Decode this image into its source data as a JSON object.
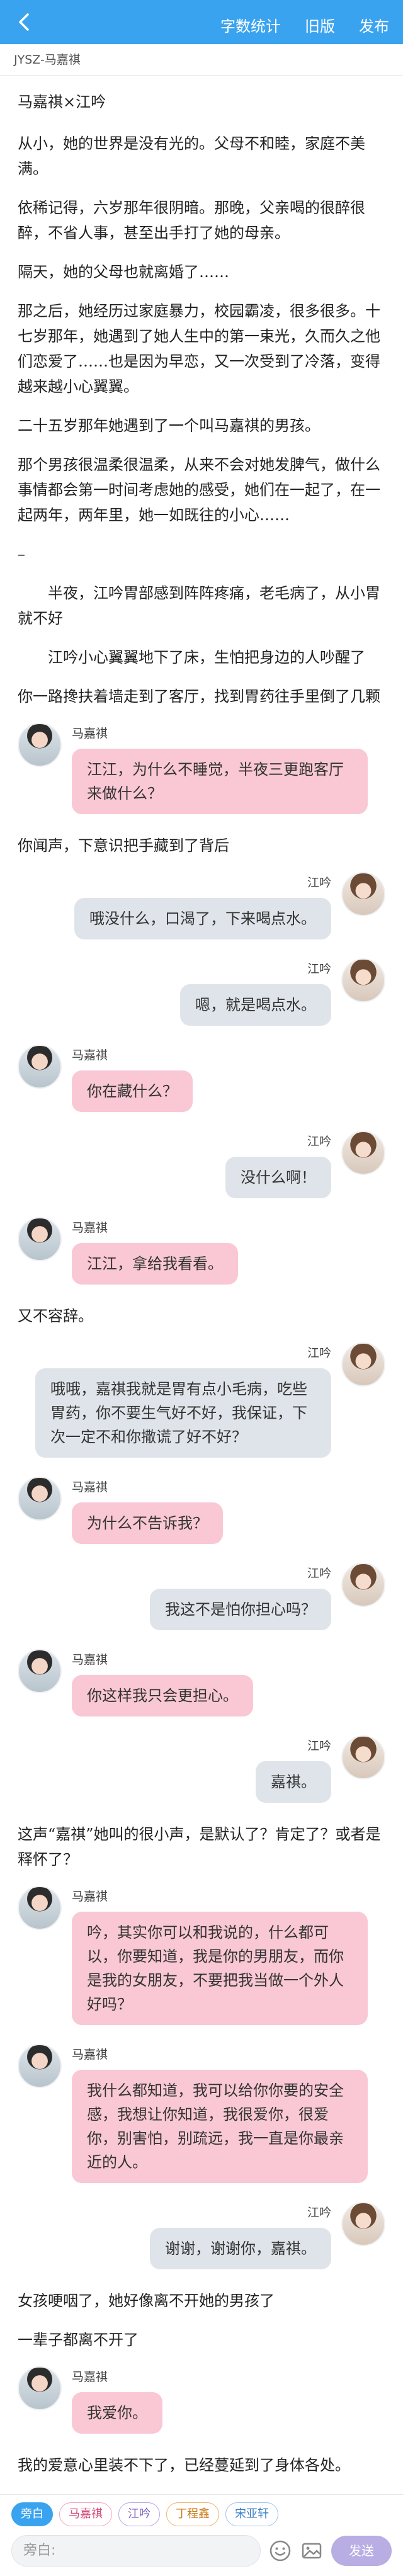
{
  "header": {
    "actions": [
      "字数统计",
      "旧版",
      "发布"
    ]
  },
  "meta": {
    "tag": "JYSZ-马嘉祺"
  },
  "blocks": [
    {
      "kind": "para",
      "style": "title",
      "text": "马嘉祺×江吟"
    },
    {
      "kind": "para",
      "text": "从小，她的世界是没有光的。父母不和睦，家庭不美满。"
    },
    {
      "kind": "para",
      "text": "依稀记得，六岁那年很阴暗。那晚，父亲喝的很醉很醉，不省人事，甚至出手打了她的母亲。"
    },
    {
      "kind": "para",
      "text": "隔天，她的父母也就离婚了……"
    },
    {
      "kind": "para",
      "text": "那之后，她经历过家庭暴力，校园霸凌，很多很多。十七岁那年，她遇到了她人生中的第一束光，久而久之他们恋爱了……也是因为早恋，又一次受到了冷落，变得越来越小心翼翼。"
    },
    {
      "kind": "para",
      "text": "二十五岁那年她遇到了一个叫马嘉祺的男孩。"
    },
    {
      "kind": "para",
      "text": "那个男孩很温柔很温柔，从来不会对她发脾气，做什么事情都会第一时间考虑她的感受，她们在一起了，在一起两年，两年里，她一如既往的小心……"
    },
    {
      "kind": "para",
      "text": "–"
    },
    {
      "kind": "para",
      "style": "indent",
      "text": "半夜，江吟胃部感到阵阵疼痛，老毛病了，从小胃就不好"
    },
    {
      "kind": "para",
      "style": "indent",
      "text": "江吟小心翼翼地下了床，生怕把身边的人吵醒了"
    },
    {
      "kind": "para",
      "text": "你一路搀扶着墙走到了客厅，找到胃药往手里倒了几颗"
    },
    {
      "kind": "msg",
      "side": "left",
      "sender": "马嘉祺",
      "text": "江江，为什么不睡觉，半夜三更跑客厅来做什么？"
    },
    {
      "kind": "para",
      "text": "你闻声，下意识把手藏到了背后"
    },
    {
      "kind": "msg",
      "side": "right",
      "sender": "江吟",
      "text": "哦没什么，口渴了，下来喝点水。"
    },
    {
      "kind": "msg",
      "side": "right",
      "sender": "江吟",
      "text": "嗯，就是喝点水。"
    },
    {
      "kind": "msg",
      "side": "left",
      "sender": "马嘉祺",
      "text": "你在藏什么？"
    },
    {
      "kind": "msg",
      "side": "right",
      "sender": "江吟",
      "text": "没什么啊！"
    },
    {
      "kind": "msg",
      "side": "left",
      "sender": "马嘉祺",
      "text": "江江，拿给我看看。"
    },
    {
      "kind": "para",
      "text": "又不容辞。"
    },
    {
      "kind": "msg",
      "side": "right",
      "sender": "江吟",
      "text": "哦哦，嘉祺我就是胃有点小毛病，吃些胃药，你不要生气好不好，我保证，下次一定不和你撒谎了好不好？"
    },
    {
      "kind": "msg",
      "side": "left",
      "sender": "马嘉祺",
      "text": "为什么不告诉我？"
    },
    {
      "kind": "msg",
      "side": "right",
      "sender": "江吟",
      "text": "我这不是怕你担心吗？"
    },
    {
      "kind": "msg",
      "side": "left",
      "sender": "马嘉祺",
      "text": "你这样我只会更担心。"
    },
    {
      "kind": "msg",
      "side": "right",
      "sender": "江吟",
      "text": "嘉祺。"
    },
    {
      "kind": "para",
      "text": "这声“嘉祺”她叫的很小声，是默认了？肯定了？或者是释怀了？"
    },
    {
      "kind": "msg",
      "side": "left",
      "sender": "马嘉祺",
      "text": "吟，其实你可以和我说的，什么都可以，你要知道，我是你的男朋友，而你是我的女朋友，不要把我当做一个外人好吗？"
    },
    {
      "kind": "msg",
      "side": "left",
      "sender": "马嘉祺",
      "text": "我什么都知道，我可以给你你要的安全感，我想让你知道，我很爱你，很爱你，别害怕，别疏远，我一直是你最亲近的人。"
    },
    {
      "kind": "msg",
      "side": "right",
      "sender": "江吟",
      "text": "谢谢，谢谢你，嘉祺。"
    },
    {
      "kind": "para",
      "text": "女孩哽咽了，她好像离不开她的男孩了"
    },
    {
      "kind": "para",
      "text": "一辈子都离不开了"
    },
    {
      "kind": "msg",
      "side": "left",
      "sender": "马嘉祺",
      "text": "我爱你。"
    },
    {
      "kind": "para",
      "text": "我的爱意心里装不下了，已经蔓延到了身体各处。"
    }
  ],
  "bottom": {
    "chips": [
      {
        "label": "旁白",
        "tone": "active"
      },
      {
        "label": "马嘉祺",
        "tone": "pink"
      },
      {
        "label": "江吟",
        "tone": "purple"
      },
      {
        "label": "丁程鑫",
        "tone": "orange"
      },
      {
        "label": "宋亚轩",
        "tone": "blue"
      }
    ],
    "input_placeholder": "旁白:",
    "send_label": "发送"
  }
}
